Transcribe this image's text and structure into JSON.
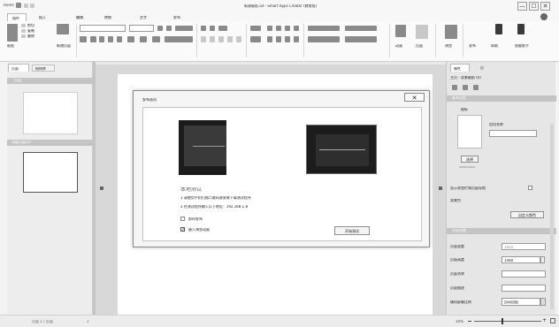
{
  "window": {
    "title": "新建磁贴.ait - Smart Apps Creator (教育版)",
    "quick_access": "Home",
    "controls": [
      "—",
      "☐",
      "✕"
    ]
  },
  "menu": {
    "tabs": [
      "插件",
      "插入",
      "编辑",
      "转换",
      "文字",
      "发布"
    ]
  },
  "ribbon": {
    "font_name": "",
    "font_size": "",
    "labels": [
      "粘贴",
      "剪切",
      "复制",
      "删除",
      "新增页面",
      "移除",
      "动画",
      "页面",
      "预览",
      "发布",
      "帮助",
      "智能助手"
    ]
  },
  "left_panel": {
    "tabs": [
      "页面",
      "结构库"
    ],
    "section_page": "页面",
    "section_frame": "母版页面(0)"
  },
  "dialog": {
    "title": "发布选项",
    "mode_title": "本地测试",
    "step1": "1 请使用手机扫描二维码或安装下载测试程序",
    "step2": "2 在测试程序输入以下地址：192.168.1.8",
    "checkbox1": "即时发布",
    "checkbox2": "嵌入预览动画",
    "checkbox2_checked": true,
    "action_button": "开始测试",
    "close": "✕"
  },
  "right_panel": {
    "tabs": [
      "属性",
      "页"
    ],
    "breadcrumb": "主页 · 背景磁贴 (0)",
    "section_basic": "基本设定",
    "icon_label": "图标",
    "icon_field_label": "应用名称",
    "icon_button": "选择",
    "icon_size": "1024×1024",
    "checkbox_label": "显示状态栏和页面导航",
    "checkbox_row2": "背景色",
    "color_button": "自定义颜色",
    "section_advanced": "分享设置",
    "fields": [
      {
        "label": "页面宽度",
        "value": "1920"
      },
      {
        "label": "页面高度",
        "value": "1080"
      },
      {
        "label": "页面名称",
        "value": ""
      },
      {
        "label": "页面描述",
        "value": ""
      },
      {
        "label": "横向屏幕比例",
        "value": "自动适配"
      }
    ]
  },
  "status": {
    "left": "页面 1 / 页面",
    "page": "1",
    "zoom": "10%"
  }
}
